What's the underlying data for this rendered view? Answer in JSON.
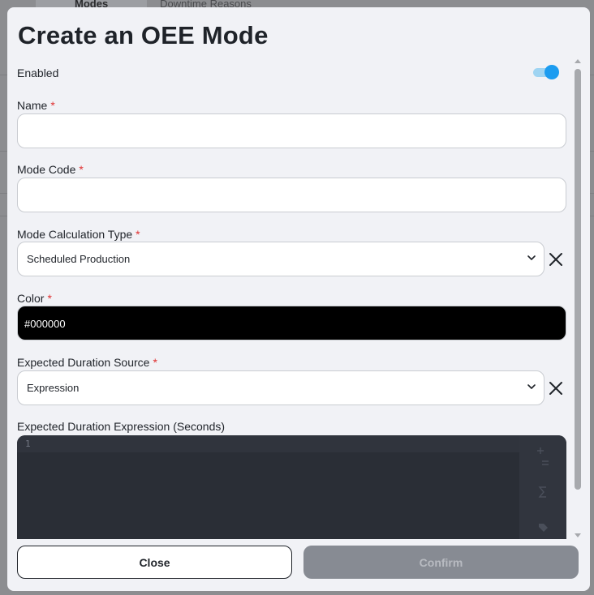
{
  "background": {
    "tabs": [
      "Modes",
      "Downtime Reasons"
    ]
  },
  "dialog": {
    "title": "Create an OEE Mode",
    "enabled": {
      "label": "Enabled",
      "value": true
    },
    "name": {
      "label": "Name",
      "required_mark": "*",
      "value": ""
    },
    "mode_code": {
      "label": "Mode Code",
      "required_mark": "*",
      "value": ""
    },
    "calc_type": {
      "label": "Mode Calculation Type",
      "required_mark": "*",
      "value": "Scheduled Production"
    },
    "color": {
      "label": "Color",
      "required_mark": "*",
      "value": "#000000"
    },
    "duration_source": {
      "label": "Expected Duration Source",
      "required_mark": "*",
      "value": "Expression"
    },
    "duration_expression": {
      "label": "Expected Duration Expression (Seconds)",
      "line_number": "1"
    },
    "icons": {
      "chevron": "chevron-down-icon",
      "clear": "close-icon",
      "operators": "operators-icon",
      "functions": "sigma-icon",
      "tags": "tag-icon"
    },
    "buttons": {
      "close": "Close",
      "confirm": "Confirm"
    }
  },
  "colors": {
    "accent": "#1c9cf0",
    "required": "#e03131",
    "editor_bg": "#2a2e36",
    "confirm_disabled": "#878b93"
  }
}
